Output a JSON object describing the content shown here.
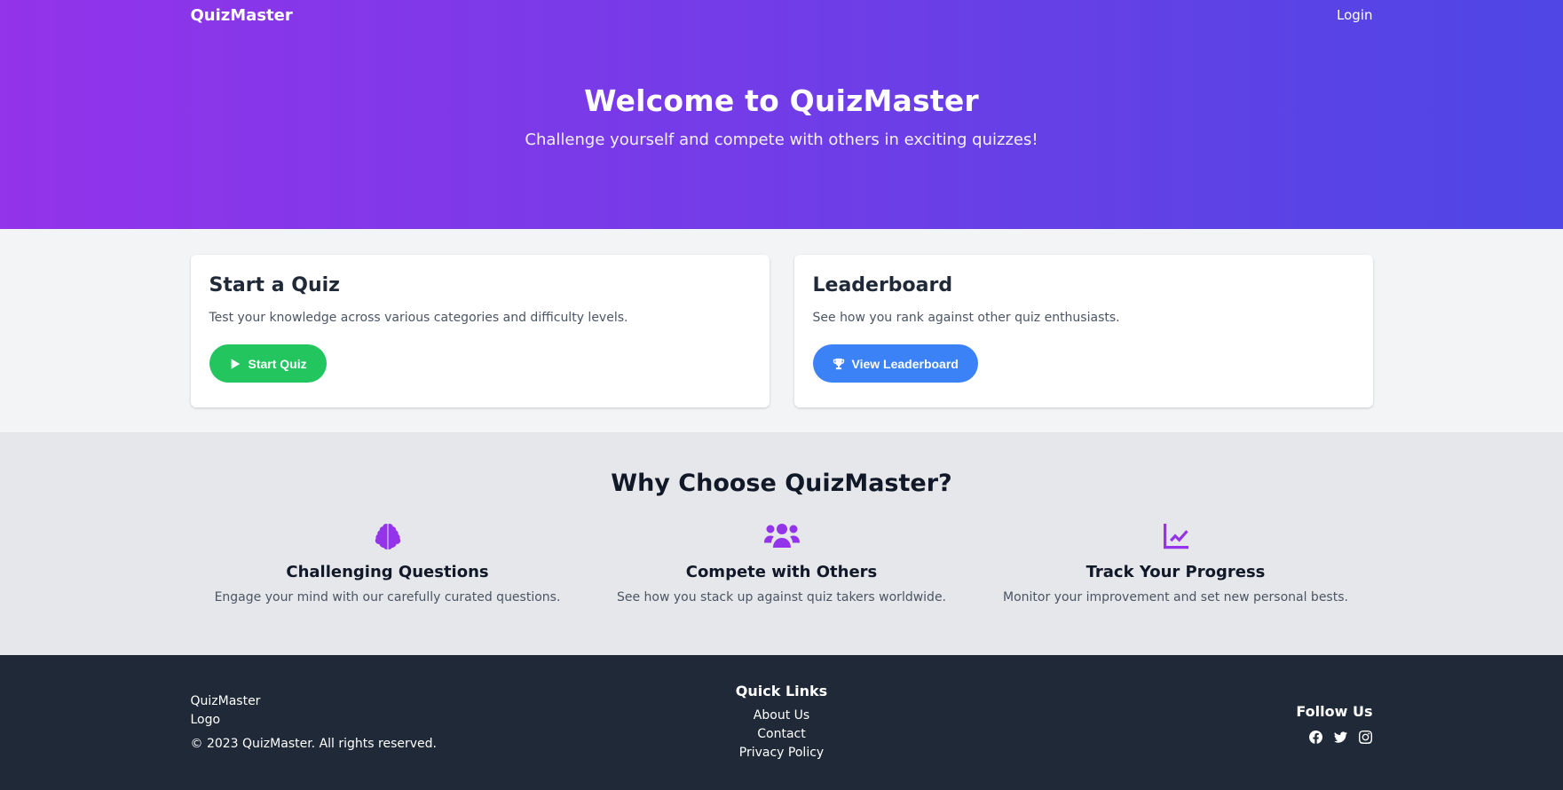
{
  "nav": {
    "brand": "QuizMaster",
    "login": "Login"
  },
  "hero": {
    "title": "Welcome to QuizMaster",
    "subtitle": "Challenge yourself and compete with others in exciting quizzes!"
  },
  "cards": [
    {
      "title": "Start a Quiz",
      "text": "Test your knowledge across various categories and difficulty levels.",
      "button": "Start Quiz",
      "icon": "play-icon",
      "color": "#22c55e"
    },
    {
      "title": "Leaderboard",
      "text": "See how you rank against other quiz enthusiasts.",
      "button": "View Leaderboard",
      "icon": "trophy-icon",
      "color": "#3b82f6"
    }
  ],
  "features": {
    "title": "Why Choose QuizMaster?",
    "items": [
      {
        "icon": "brain-icon",
        "title": "Challenging Questions",
        "text": "Engage your mind with our carefully curated questions."
      },
      {
        "icon": "users-icon",
        "title": "Compete with Others",
        "text": "See how you stack up against quiz takers worldwide."
      },
      {
        "icon": "chart-line-icon",
        "title": "Track Your Progress",
        "text": "Monitor your improvement and set new personal bests."
      }
    ]
  },
  "footer": {
    "logo_alt": "QuizMaster Logo",
    "copyright": "© 2023 QuizMaster. All rights reserved.",
    "quick_links_heading": "Quick Links",
    "links": [
      "About Us",
      "Contact",
      "Privacy Policy"
    ],
    "follow_heading": "Follow Us",
    "socials": [
      "facebook-icon",
      "twitter-icon",
      "instagram-icon"
    ]
  },
  "colors": {
    "gradient_start": "#9333ea",
    "gradient_end": "#4f46e5",
    "accent": "#9333ea",
    "footer_bg": "#1f2937"
  }
}
